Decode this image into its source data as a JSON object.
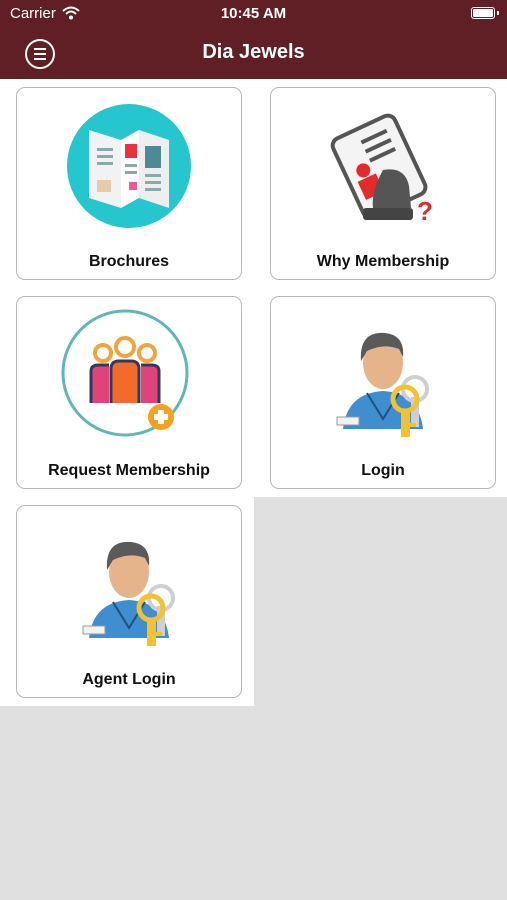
{
  "status_bar": {
    "carrier": "Carrier",
    "time": "10:45 AM"
  },
  "header": {
    "title": "Dia Jewels"
  },
  "tiles": [
    {
      "label": "Brochures",
      "icon": "brochure-icon"
    },
    {
      "label": "Why Membership",
      "icon": "membership-card-question-icon"
    },
    {
      "label": "Request Membership",
      "icon": "group-add-icon"
    },
    {
      "label": "Login",
      "icon": "user-key-icon"
    },
    {
      "label": "Agent Login",
      "icon": "agent-key-icon"
    }
  ],
  "colors": {
    "header": "#5f1f24",
    "background": "#e0e0e0",
    "card_border": "#b7b7b7"
  }
}
